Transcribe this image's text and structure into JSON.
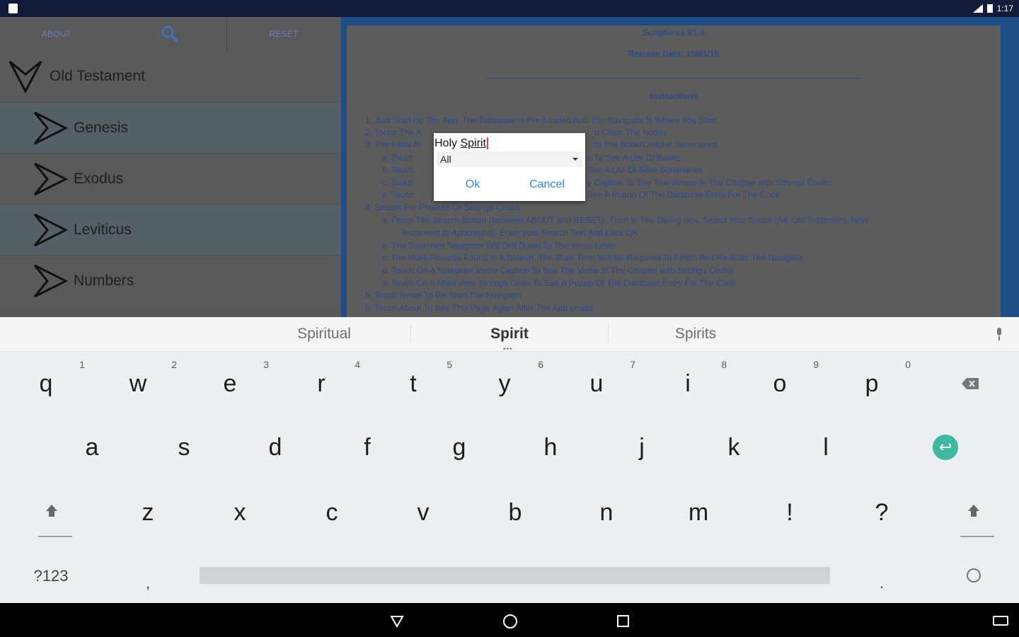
{
  "status_bar": {
    "time": "1:17"
  },
  "toolbar": {
    "about_label": "ABOUT",
    "reset_label": "RESET"
  },
  "tree": {
    "root_label": "Old Testament",
    "children": [
      "Genesis",
      "Exodus",
      "Leviticus",
      "Numbers"
    ]
  },
  "document": {
    "title": "Scriptures V1.0",
    "release": "Release Date: 10/01/16",
    "instructions_heading": "Instructions",
    "lines": [
      "1.  Just Start Up The App. The Database Is Pre-Loaded And The Navigator Is Where You Start",
      "2.  Touch The A",
      "d Close The Nodes",
      "3.  The Initial Ar",
      "To The Book/Chapter Summaries",
      "a.  Touch",
      "e To See A List Of Books",
      "b.  Touch",
      "See A List Of Bible Summaries",
      "c.  Touch",
      "y Caption To See The Verses In The Chapter with Strongs Codes",
      "d.  Touch",
      "See A Popup Of The Database Entry For The Code",
      "4.  Search For Phrases Or Strongs Codes",
      "a.  Press The Search Button (between ABOUT and RESET). Then In The Dialog Box, Select Your Scope (All, Old Testament, New",
      "Testament or Apocrypha). Enter your Search Text And Click OK",
      "b.  The Searched Navigator Will Drill Down To The Verse Level",
      "c.  The More Records Found In A Search, The More Time Will Be Required To Finish And Re-Build The Navigator",
      "d.  Touch On A Navigator Verse Caption To See The Verse In The Chapter with Strongs Codes",
      "e.  Touch On A Main View Strongs Code To See A Popup Of The Database Entry For The Code",
      "5.  Touch Reset To Re-Start The Navigator",
      "6.  Touch About To See This Page Again After The App Loads"
    ]
  },
  "dialog": {
    "search_text_prefix": "Holy ",
    "search_text_word": "Spirit",
    "scope_selected": "All",
    "ok_label": "Ok",
    "cancel_label": "Cancel"
  },
  "keyboard": {
    "suggestions": [
      "Spiritual",
      "Spirit",
      "Spirits"
    ],
    "row1": [
      {
        "k": "q",
        "h": "1"
      },
      {
        "k": "w",
        "h": "2"
      },
      {
        "k": "e",
        "h": "3"
      },
      {
        "k": "r",
        "h": "4"
      },
      {
        "k": "t",
        "h": "5"
      },
      {
        "k": "y",
        "h": "6"
      },
      {
        "k": "u",
        "h": "7"
      },
      {
        "k": "i",
        "h": "8"
      },
      {
        "k": "o",
        "h": "9"
      },
      {
        "k": "p",
        "h": "0"
      }
    ],
    "row2": [
      "a",
      "s",
      "d",
      "f",
      "g",
      "h",
      "j",
      "k",
      "l"
    ],
    "row3": [
      "z",
      "x",
      "c",
      "v",
      "b",
      "n",
      "m",
      "!",
      "?"
    ],
    "symbols_label": "?123",
    "comma_label": ",",
    "period_label": "."
  }
}
